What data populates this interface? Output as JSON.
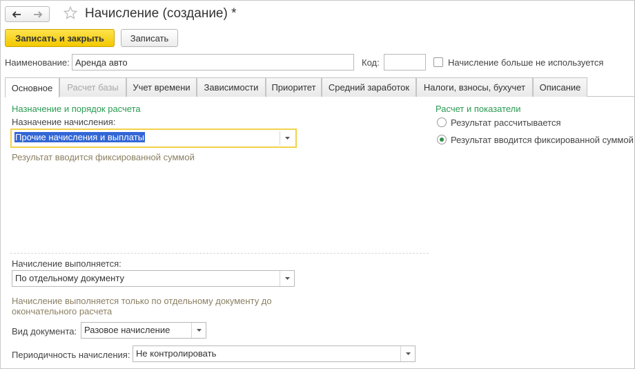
{
  "window": {
    "title": "Начисление (создание) *"
  },
  "toolbar": {
    "save_close_label": "Записать и закрыть",
    "save_label": "Записать"
  },
  "form": {
    "name_label": "Наименование:",
    "name_value": "Аренда авто",
    "code_label": "Код:",
    "code_value": "",
    "unused_checkbox_label": "Начисление больше не используется",
    "unused_checked": false
  },
  "tabs": [
    {
      "label": "Основное",
      "active": true,
      "disabled": false
    },
    {
      "label": "Расчет базы",
      "active": false,
      "disabled": true
    },
    {
      "label": "Учет времени",
      "active": false,
      "disabled": false
    },
    {
      "label": "Зависимости",
      "active": false,
      "disabled": false
    },
    {
      "label": "Приоритет",
      "active": false,
      "disabled": false
    },
    {
      "label": "Средний заработок",
      "active": false,
      "disabled": false
    },
    {
      "label": "Налоги, взносы, бухучет",
      "active": false,
      "disabled": false
    },
    {
      "label": "Описание",
      "active": false,
      "disabled": false
    }
  ],
  "main": {
    "purpose_section_title": "Назначение и порядок расчета",
    "purpose_label": "Назначение начисления:",
    "purpose_value": "Прочие начисления и выплаты",
    "purpose_hint": "Результат вводится фиксированной суммой",
    "execution_label": "Начисление выполняется:",
    "execution_value": "По отдельному документу",
    "execution_hint_line1": "Начисление выполняется только по отдельному документу до",
    "execution_hint_line2": "окончательного расчета",
    "doc_type_label": "Вид документа:",
    "doc_type_value": "Разовое начисление",
    "periodicity_label": "Периодичность начисления:",
    "periodicity_value": "Не контролировать"
  },
  "calc": {
    "section_title": "Расчет и показатели",
    "option_calculated": "Результат рассчитывается",
    "option_fixed": "Результат вводится фиксированной суммой",
    "selected": "fixed"
  },
  "colors": {
    "accent_green": "#2a9a52",
    "primary_button": "#f2c800",
    "focus_border": "#f2d24a",
    "selection": "#3367d6",
    "hint_text": "#8a7f62"
  },
  "icons": {
    "back": "arrow-left-icon",
    "forward": "arrow-right-icon",
    "favorite": "star-outline-icon",
    "dropdown": "triangle-down-icon"
  }
}
